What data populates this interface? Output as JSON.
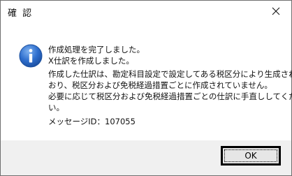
{
  "dialog": {
    "title": "確 認",
    "close_icon": "close-icon",
    "info_icon": "info-icon",
    "message_lines_1": [
      "作成処理を完了しました。",
      "X仕訳を作成しました。"
    ],
    "message_lines_2": [
      "作成した仕訳は、勘定科目設定で設定してある税区分により生成されて",
      "おり、税区分および免税経過措置ごとに作成されていません。",
      "必要に応じて税区分および免税経過措置ごとの仕訳に手直ししてくださ",
      "い。"
    ],
    "message_id": "メッセージID：107055",
    "ok_label": "OK"
  },
  "colors": {
    "accent": "#1f5fbf",
    "footer": "#f0f0f0"
  }
}
